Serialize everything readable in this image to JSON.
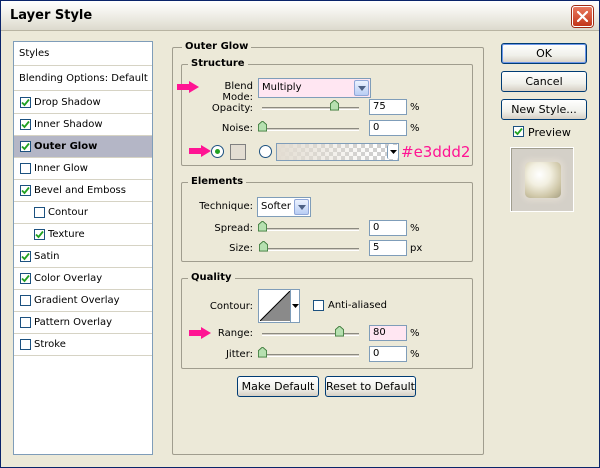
{
  "window": {
    "title": "Layer Style"
  },
  "styles_panel": {
    "header": "Styles",
    "blending": "Blending Options: Default",
    "items": [
      {
        "label": "Drop Shadow",
        "checked": true,
        "indent": false,
        "selected": false
      },
      {
        "label": "Inner Shadow",
        "checked": true,
        "indent": false,
        "selected": false
      },
      {
        "label": "Outer Glow",
        "checked": true,
        "indent": false,
        "selected": true
      },
      {
        "label": "Inner Glow",
        "checked": false,
        "indent": false,
        "selected": false
      },
      {
        "label": "Bevel and Emboss",
        "checked": true,
        "indent": false,
        "selected": false
      },
      {
        "label": "Contour",
        "checked": false,
        "indent": true,
        "selected": false
      },
      {
        "label": "Texture",
        "checked": true,
        "indent": true,
        "selected": false
      },
      {
        "label": "Satin",
        "checked": true,
        "indent": false,
        "selected": false
      },
      {
        "label": "Color Overlay",
        "checked": true,
        "indent": false,
        "selected": false
      },
      {
        "label": "Gradient Overlay",
        "checked": false,
        "indent": false,
        "selected": false
      },
      {
        "label": "Pattern Overlay",
        "checked": false,
        "indent": false,
        "selected": false
      },
      {
        "label": "Stroke",
        "checked": false,
        "indent": false,
        "selected": false
      }
    ]
  },
  "outer_glow": {
    "title": "Outer Glow",
    "structure": {
      "title": "Structure",
      "blend_mode_label": "Blend Mode:",
      "blend_mode_value": "Multiply",
      "opacity_label": "Opacity:",
      "opacity_value": "75",
      "opacity_level": 0.75,
      "opacity_unit": "%",
      "noise_label": "Noise:",
      "noise_value": "0",
      "noise_level": 0,
      "noise_unit": "%",
      "color_hex_annotation": "#e3ddd2",
      "glow_color": "#e3ddd2"
    },
    "elements": {
      "title": "Elements",
      "technique_label": "Technique:",
      "technique_value": "Softer",
      "spread_label": "Spread:",
      "spread_value": "0",
      "spread_level": 0,
      "spread_unit": "%",
      "size_label": "Size:",
      "size_value": "5",
      "size_level": 0.02,
      "size_unit": "px"
    },
    "quality": {
      "title": "Quality",
      "contour_label": "Contour:",
      "anti_aliased_label": "Anti-aliased",
      "anti_aliased_checked": false,
      "range_label": "Range:",
      "range_value": "80",
      "range_level": 0.8,
      "range_unit": "%",
      "jitter_label": "Jitter:",
      "jitter_value": "0",
      "jitter_level": 0,
      "jitter_unit": "%"
    },
    "make_default_label": "Make Default",
    "reset_default_label": "Reset to Default"
  },
  "actions": {
    "ok_label": "OK",
    "cancel_label": "Cancel",
    "new_style_label": "New Style...",
    "preview_label": "Preview",
    "preview_checked": true
  },
  "colors": {
    "highlight_pink": "#ff1493",
    "field_pink": "#ffe6f2"
  }
}
